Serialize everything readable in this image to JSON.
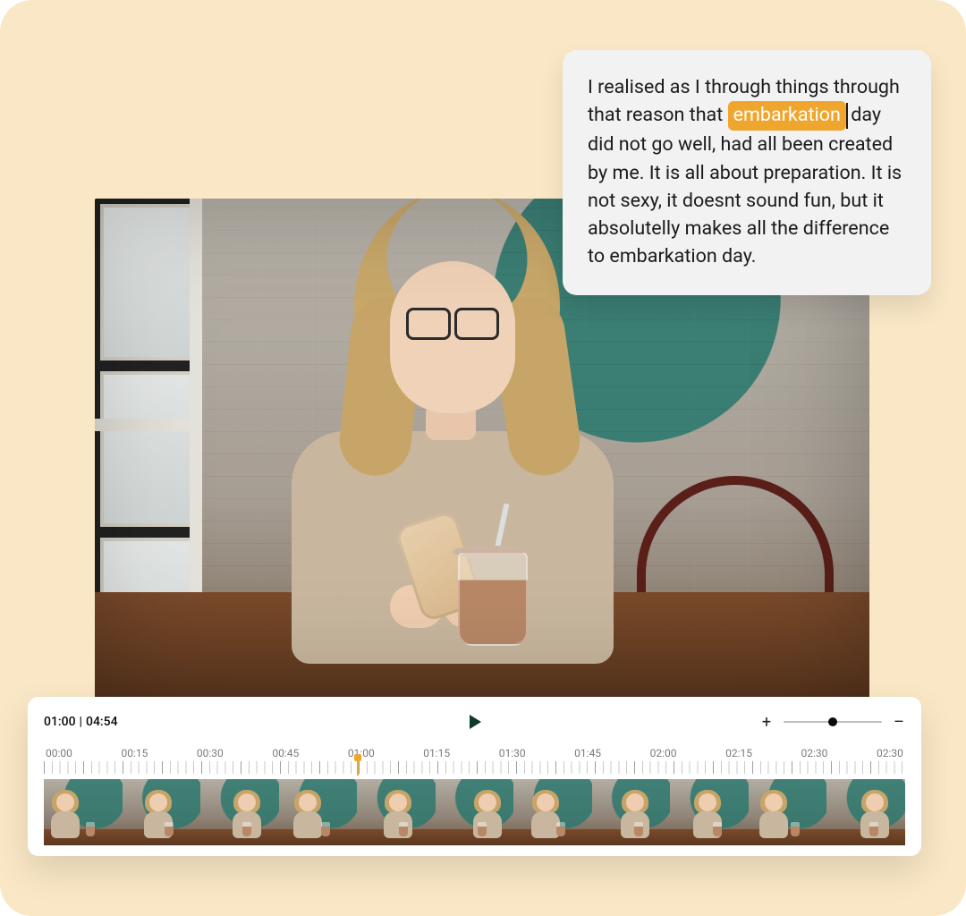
{
  "transcript": {
    "pre": "I realised as I through things through that reason that ",
    "highlight": "embarkation",
    "post": " day did not go well, had all been created by me. It is all about preparation. It is not sexy, it doesnt sound fun, but it absolutelly makes all the difference to embarkation day."
  },
  "player": {
    "current_time": "01:00",
    "total_time": "04:54",
    "zoom_percent": 50,
    "playhead_fraction": 0.363,
    "ruler_labels": [
      "00:00",
      "00:15",
      "00:30",
      "00:45",
      "01:00",
      "01:15",
      "01:30",
      "01:45",
      "02:00",
      "02:15",
      "02:30",
      "02:30"
    ],
    "thumb_count": 11
  },
  "icons": {
    "play": "play-icon",
    "zoom_in": "+",
    "zoom_out": "–"
  }
}
